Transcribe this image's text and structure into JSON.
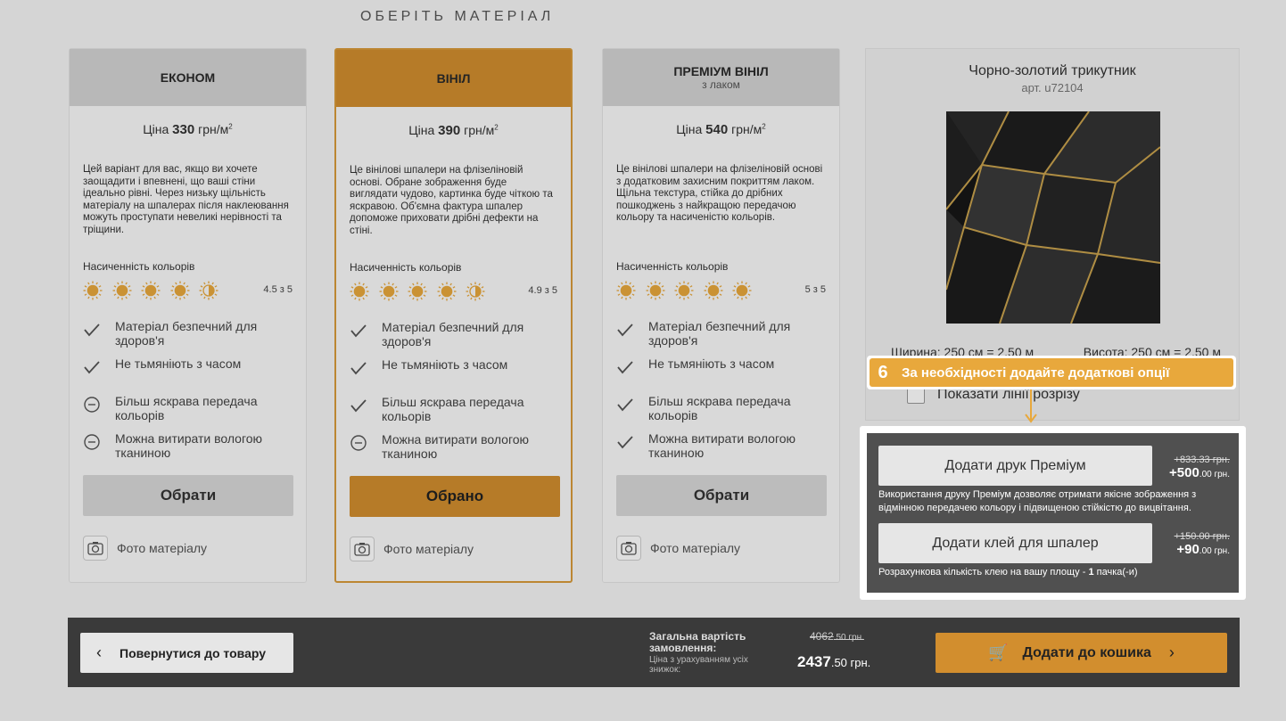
{
  "heading": "ОБЕРІТЬ МАТЕРІАЛ",
  "colors": {
    "accent": "#d28e2e",
    "tip": "#e8a83c",
    "dark": "#3a3a3a",
    "panel": "#505050"
  },
  "cards": [
    {
      "title": "ЕКОНОМ",
      "subtitle": "",
      "price_prefix": "Ціна",
      "price_value": "330",
      "price_unit": "грн/м",
      "description": "Цей варіант для вас, якщо ви хочете заощадити і впевнені, що ваші стіни ідеально рівні. Через низьку щільність матеріалу на шпалерах після наклеювання можуть проступати невеликі нерівності та тріщини.",
      "saturation_label": "Насиченність кольорів",
      "rating": 4.5,
      "score_text": "4.5 з 5",
      "features": [
        {
          "icon": "check-icon",
          "text": "Матеріал безпечний для здоров'я"
        },
        {
          "icon": "check-icon",
          "text": "Не тьмяніють з часом"
        },
        {
          "icon": "minus-circle-icon",
          "text": "Більш яскрава передача кольорів"
        },
        {
          "icon": "minus-circle-icon",
          "text": "Можна витирати вологою тканиною"
        }
      ],
      "button": "Обрати",
      "photo_label": "Фото матеріалу"
    },
    {
      "title": "ВІНІЛ",
      "subtitle": "",
      "price_prefix": "Ціна",
      "price_value": "390",
      "price_unit": "грн/м",
      "description": "Це вінілові шпалери на флізеліновій основі. Обране зображення буде виглядати чудово, картинка буде чіткою та яскравою. Об'ємна фактура шпалер допоможе приховати дрібні дефекти на стіні.",
      "saturation_label": "Насиченність кольорів",
      "rating": 4.9,
      "score_text": "4.9 з 5",
      "features": [
        {
          "icon": "check-icon",
          "text": "Матеріал безпечний для здоров'я"
        },
        {
          "icon": "check-icon",
          "text": "Не тьмяніють з часом"
        },
        {
          "icon": "check-icon",
          "text": "Більш яскрава передача кольорів"
        },
        {
          "icon": "minus-circle-icon",
          "text": "Можна витирати вологою тканиною"
        }
      ],
      "button": "Обрано",
      "photo_label": "Фото матеріалу"
    },
    {
      "title": "ПРЕМІУМ ВІНІЛ",
      "subtitle": "з лаком",
      "price_prefix": "Ціна",
      "price_value": "540",
      "price_unit": "грн/м",
      "description": "Це вінілові шпалери на флізеліновій основі з додатковим захисним покриттям лаком. Щільна текстура, стійка до дрібних пошкоджень з найкращою передачою кольору та насиченістю кольорів.",
      "saturation_label": "Насиченність кольорів",
      "rating": 5,
      "score_text": "5 з 5",
      "features": [
        {
          "icon": "check-icon",
          "text": "Матеріал безпечний для здоров'я"
        },
        {
          "icon": "check-icon",
          "text": "Не тьмяніють з часом"
        },
        {
          "icon": "check-icon",
          "text": "Більш яскрава передача кольорів"
        },
        {
          "icon": "check-icon",
          "text": "Можна витирати вологою тканиною"
        }
      ],
      "button": "Обрати",
      "photo_label": "Фото матеріалу"
    }
  ],
  "product": {
    "title": "Чорно-золотий трикутник",
    "article": "арт. u72104",
    "width_text": "Ширина: 250 см = 2.50 м",
    "height_text": "Висота: 250 см = 2.50 м",
    "cutline_label": "Показати лінії розрізу"
  },
  "tip": {
    "number": "6",
    "text": "За необхідності додайте додаткові опції"
  },
  "options": {
    "print": {
      "button": "Додати друк Преміум",
      "old_price": "+833.33 грн.",
      "new_price_main": "+500",
      "new_price_rest": ".00 грн.",
      "description": "Використання друку Преміум дозволяє отримати якісне зображення з відмінною передачею кольору і підвищеною стійкістю до вицвітання."
    },
    "glue": {
      "button": "Додати клей для шпалер",
      "old_price": "+150.00 грн.",
      "new_price_main": "+90",
      "new_price_rest": ".00 грн.",
      "description_prefix": "Розрахункова кількість клею на вашу площу - ",
      "description_count": "1",
      "description_suffix": " пачка(-и)"
    }
  },
  "footer": {
    "back_button": "Повернутися до товару",
    "total_label": "Загальна вартість замовлення:",
    "total_note": "Ціна з урахуванням усіх знижок:",
    "old_total_main": "4062",
    "old_total_rest": ".50 грн.",
    "new_total_main": "2437",
    "new_total_rest": ".50 грн.",
    "cart_button": "Додати до кошика"
  }
}
